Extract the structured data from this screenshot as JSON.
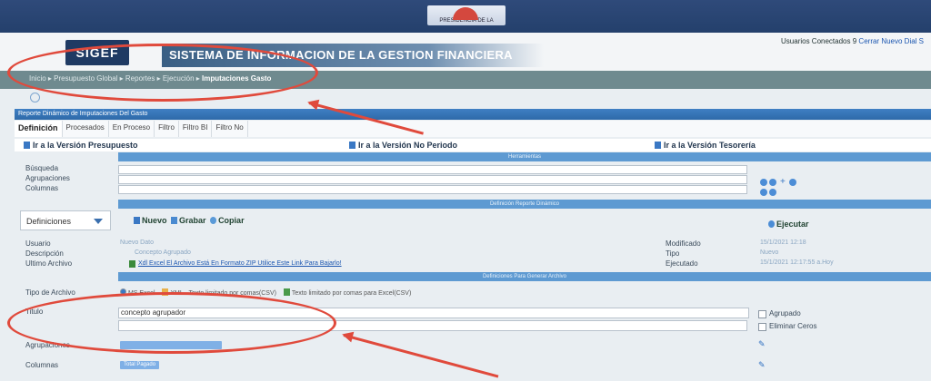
{
  "banner": {
    "seal_text": "PRESIDENCIA DE LA REPUBLICA"
  },
  "header": {
    "logo": "SIGEF",
    "system_name": "SISTEMA DE INFORMACION DE LA GESTION FINANCIERA",
    "users_label": "Usuarios Conectados",
    "users_count": "9",
    "users_links": "Cerrar  Nuevo Dial  S"
  },
  "breadcrumb": {
    "items": [
      "Inicio",
      "Presupuesto Global",
      "Reportes",
      "Ejecución"
    ],
    "current": "Imputaciones Gasto"
  },
  "panel": {
    "title": "Reporte Dinámico de Imputaciones Del Gasto"
  },
  "tabs": [
    "Definición",
    "Procesados",
    "En Proceso",
    "Filtro",
    "Filtro BI",
    "Filtro No"
  ],
  "versions": {
    "presupuesto": "Ir a la Versión Presupuesto",
    "no_periodo": "Ir a la Versión No Periodo",
    "tesoreria": "Ir a la Versión Tesorería"
  },
  "herramientas": {
    "header": "Herramientas",
    "busqueda": "Búsqueda",
    "agrupaciones": "Agrupaciones",
    "columnas": "Columnas"
  },
  "definicion": {
    "header": "Definición Reporte Dinámico",
    "select_value": "Definiciones",
    "nuevo": "Nuevo",
    "grabar": "Grabar",
    "copiar": "Copiar",
    "ejecutar": "Ejecutar",
    "usuario_label": "Usuario",
    "usuario_value": "Nuevo Dato",
    "descripcion_label": "Descripción",
    "descripcion_value": "Concepto Agrupado",
    "ultimo_label": "Ultimo Archivo",
    "ultimo_link": "Xdl Excel  El Archivo Está En Formato ZIP  Utilice Este Link Para Bajarlo!",
    "modificado_label": "Modificado",
    "modificado_value": "15/1/2021 12:18",
    "tipo_label": "Tipo",
    "tipo_value": "Nuevo",
    "ejecutado_label": "Ejecutado",
    "ejecutado_value": "15/1/2021 12:17:55 a.Hoy"
  },
  "generar": {
    "header": "Definiciones Para Generar Archivo",
    "tipo_label": "Tipo de Archivo",
    "opt1": "MS Excel",
    "opt2": "XML",
    "opt3": "Texto limitado por comas(CSV)",
    "opt4": "Texto limitado por comas para Excel(CSV)",
    "titulo_label": "Titulo",
    "titulo_value": "concepto agrupador",
    "agrupado": "Agrupado",
    "eliminar_ceros": "Eliminar Ceros",
    "agrupaciones_label": "Agrupaciones",
    "columnas_label": "Columnas",
    "columnas_btn": "Total Pagado"
  },
  "colors": {
    "annotation": "#e04a3c",
    "accent": "#3f7fc3"
  }
}
